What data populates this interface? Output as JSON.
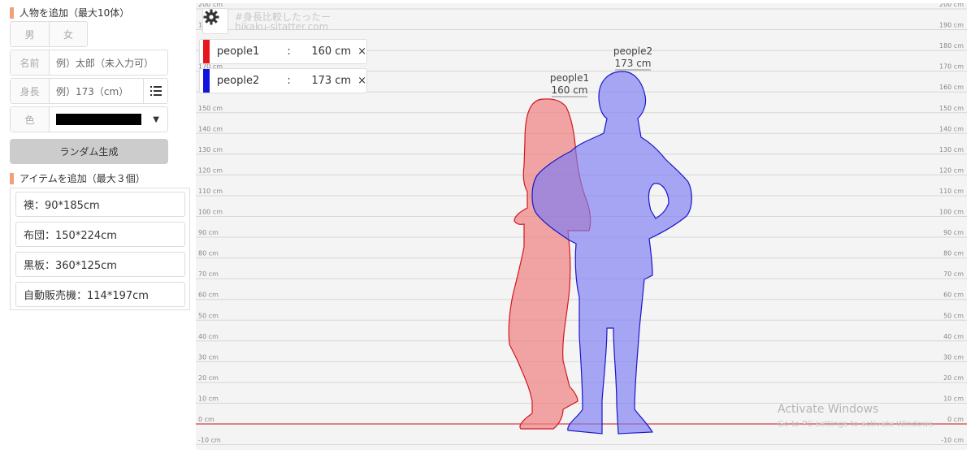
{
  "sidebar": {
    "person_section_title": "人物を追加（最大10体）",
    "gender": {
      "male": "男",
      "female": "女"
    },
    "name": {
      "label": "名前",
      "placeholder": "例）太郎（未入力可）"
    },
    "height": {
      "label": "身長",
      "placeholder": "例）173（cm）"
    },
    "color": {
      "label": "色",
      "value": "#000000"
    },
    "random_button": "ランダム生成",
    "item_section_title": "アイテムを追加（最大３個）",
    "items": [
      {
        "label": "襖：90*185cm"
      },
      {
        "label": "布団：150*224cm"
      },
      {
        "label": "黒板：360*125cm"
      },
      {
        "label": "自動販売機：114*197cm"
      }
    ]
  },
  "canvas": {
    "watermark_title": "#身長比較したったー",
    "watermark_url": "hikaku-sitatter.com",
    "scale": {
      "min": -10,
      "max": 200,
      "step": 10,
      "unit": "cm"
    },
    "people": [
      {
        "name": "people1",
        "colon": ":",
        "height": 160,
        "height_text": "160 cm",
        "color": "#e8141c",
        "remove": "×"
      },
      {
        "name": "people2",
        "colon": ":",
        "height": 173,
        "height_text": "173 cm",
        "color": "#1414e0",
        "remove": "×"
      }
    ],
    "figure_labels": [
      {
        "name": "people1",
        "height_text": "160 cm"
      },
      {
        "name": "people2",
        "height_text": "173 cm"
      }
    ]
  },
  "overlay": {
    "activate_title": "Activate Windows",
    "activate_sub": "Go to PC settings to activate Windows."
  }
}
